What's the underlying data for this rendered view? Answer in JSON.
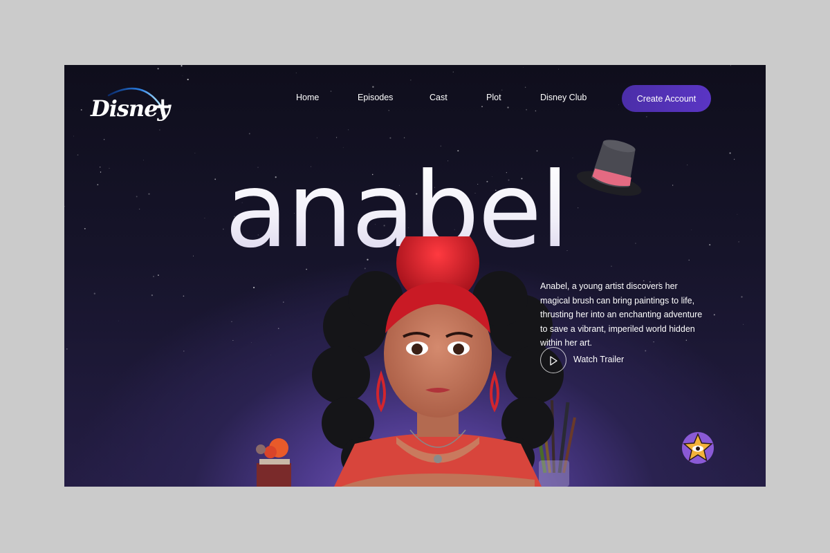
{
  "brand": {
    "logo_text": "Disney",
    "logo_plus": "+",
    "name": "Disney+"
  },
  "nav": {
    "items": [
      {
        "label": "Home"
      },
      {
        "label": "Episodes"
      },
      {
        "label": "Cast"
      },
      {
        "label": "Plot"
      },
      {
        "label": "Disney Club"
      }
    ],
    "cta_label": "Create Account"
  },
  "hero": {
    "title": "anabel",
    "description": "Anabel, a young artist discovers her magical brush can bring paintings to life, thrusting her into an enchanting adventure to save a vibrant, imperiled world hidden within her art.",
    "trailer_label": "Watch Trailer"
  },
  "icons": {
    "logo": "disney-plus-logo",
    "hat": "top-hat-icon",
    "play": "play-icon",
    "badge": "star-eye-badge-icon"
  },
  "colors": {
    "page_bg": "#cbcbcb",
    "hero_bg": "#16142a",
    "accent": "#5a35c4",
    "glow": "#7a5dc4",
    "hair": "#d9232d"
  }
}
